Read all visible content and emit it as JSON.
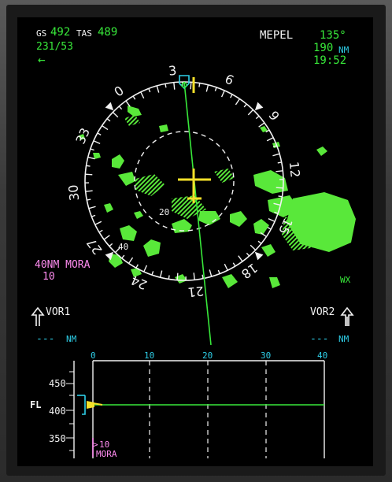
{
  "top_left": {
    "gs_label": "GS",
    "gs_value": "492",
    "tas_label": "TAS",
    "tas_value": "489",
    "wind": "231/53",
    "wind_arrow": "←"
  },
  "top_right": {
    "waypoint": "MEPEL",
    "bearing": "135°",
    "distance": "190",
    "distance_unit": "NM",
    "eta": "19:52"
  },
  "compass": {
    "labels": [
      "33",
      "30",
      "27",
      "24",
      "21",
      "18",
      "15",
      "12",
      "9",
      "6",
      "3",
      "0"
    ],
    "range_ring_label": "20",
    "outer_ring_label": "40"
  },
  "mora": {
    "label": "40NM MORA",
    "value": "10"
  },
  "wx_label": "WX",
  "vor1": {
    "label": "VOR1",
    "dashes": "---",
    "unit": "NM"
  },
  "vor2": {
    "label": "VOR2",
    "dashes": "---",
    "unit": "NM"
  },
  "vertical_display": {
    "distance_ticks": [
      "0",
      "10",
      "20",
      "30",
      "40"
    ],
    "altitude_ticks": [
      "450",
      "400",
      "350"
    ],
    "fl_label": "FL",
    "mora_value": "10",
    "mora_label": "MORA"
  },
  "colors": {
    "green": "#38e83a",
    "cyan": "#2ecfe8",
    "magenta": "#ff8cf0",
    "yellow": "#f4e02a",
    "white": "#f2f2f2",
    "weather": "#59e83a"
  }
}
